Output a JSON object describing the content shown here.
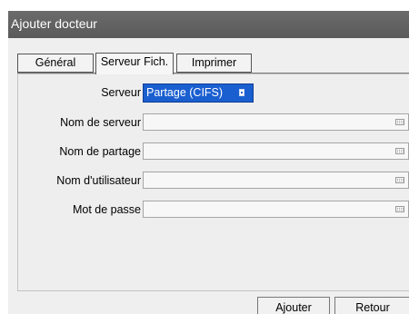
{
  "window": {
    "title": "Ajouter docteur"
  },
  "tabs": [
    {
      "label": "Général"
    },
    {
      "label": "Serveur Fich."
    },
    {
      "label": "Imprimer"
    }
  ],
  "form": {
    "server_label": "Serveur",
    "server_value": "Partage (CIFS)",
    "server_name_label": "Nom de serveur",
    "server_name_value": "",
    "share_name_label": "Nom de partage",
    "share_name_value": "",
    "username_label": "Nom d'utilisateur",
    "username_value": "",
    "password_label": "Mot de passe",
    "password_value": ""
  },
  "buttons": {
    "add": "Ajouter",
    "back": "Retour"
  },
  "colors": {
    "titlebar": "#5f5f5f",
    "selection": "#1a5fd0",
    "dialog_bg": "#efefef"
  },
  "icons": {
    "field_icon": "keyboard-icon",
    "select_icon": "dropdown-icon"
  }
}
